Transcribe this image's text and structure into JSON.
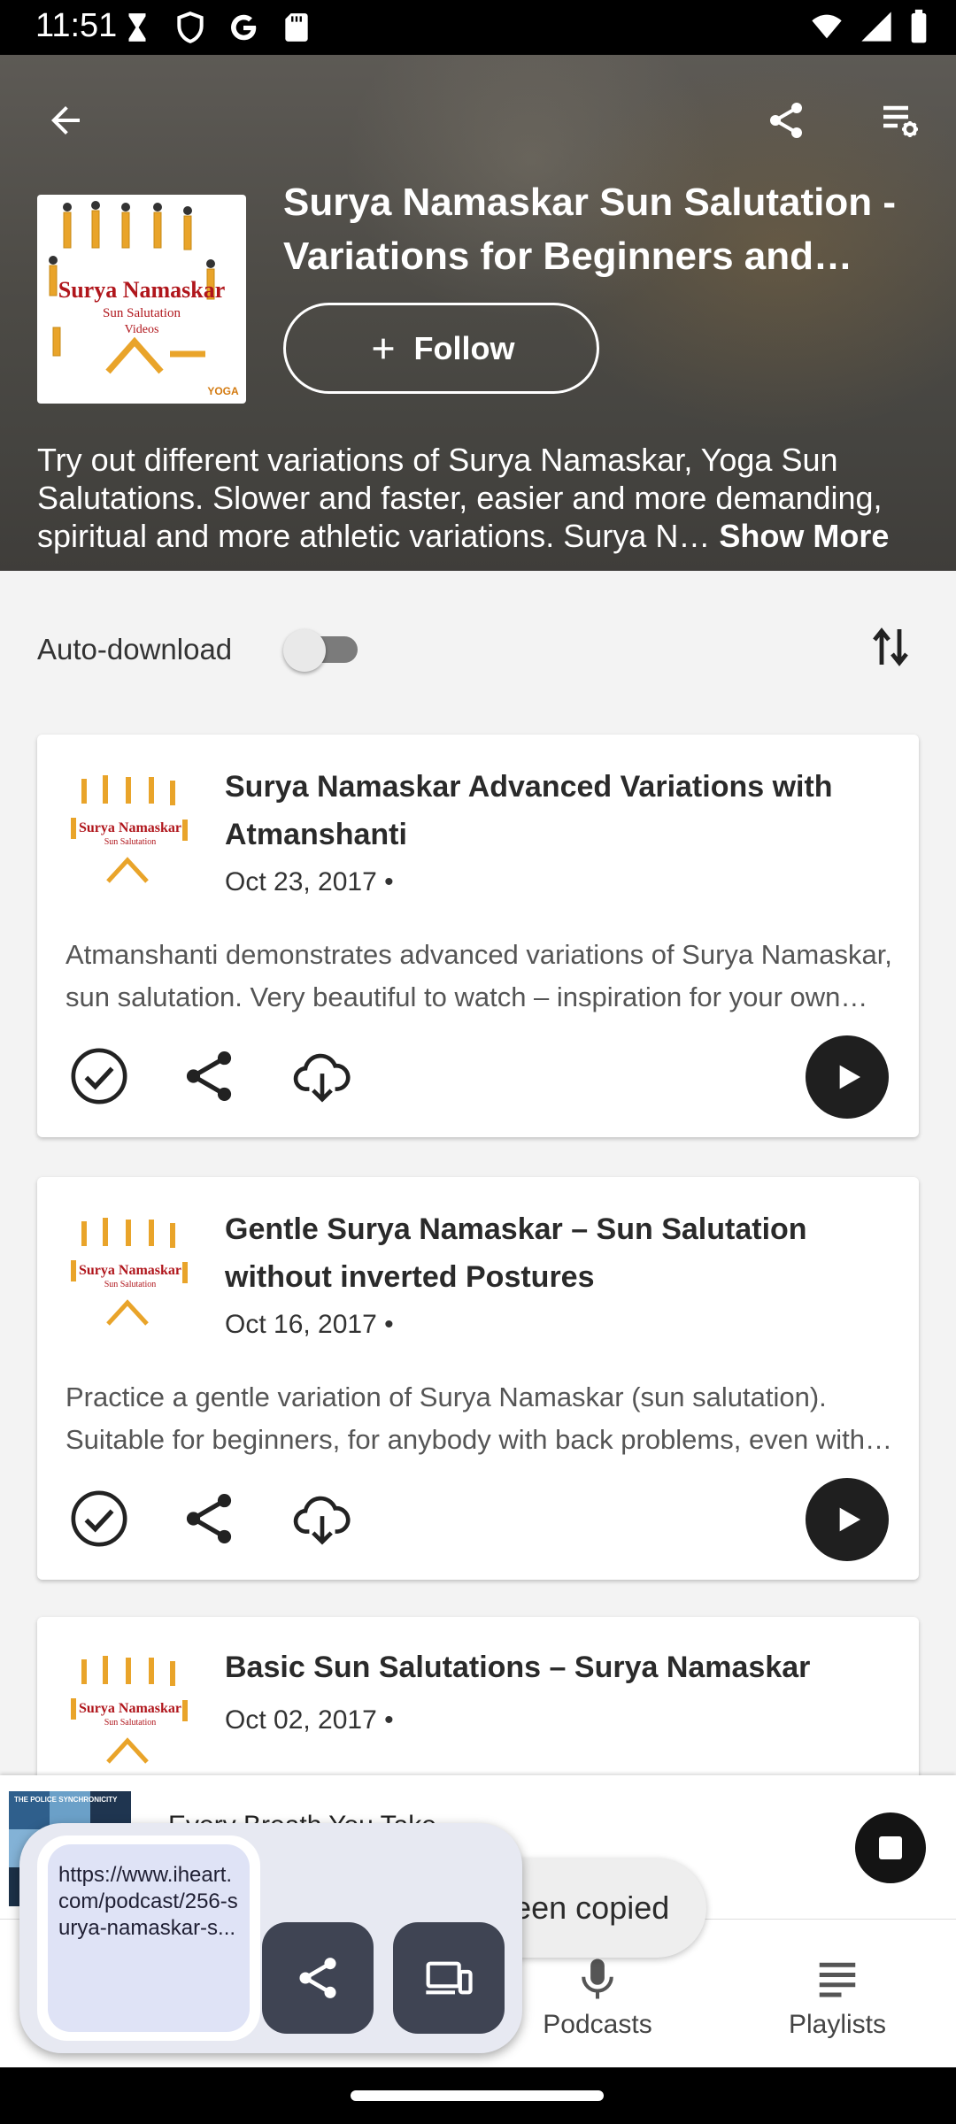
{
  "status_bar": {
    "time": "11:51",
    "icons": [
      "hourglass-icon",
      "shield-icon",
      "google-icon",
      "sd-card-icon"
    ],
    "right_icons": [
      "wifi-icon",
      "signal-icon",
      "battery-icon"
    ]
  },
  "header": {
    "title": "Surya Namaskar Sun Salutation - Variations for Beginners and Advanced",
    "follow_label": "Follow",
    "cover_text_line1": "Surya Namaskar",
    "cover_text_line2": "Sun Salutation",
    "cover_text_line3": "Videos",
    "cover_badge": "YOGA",
    "description": "Try out different variations of Surya Namaskar, Yoga Sun Salutations. Slower and faster, easier and more demanding, spiritual and more athletic variations. Surya N…",
    "show_more_label": "Show More"
  },
  "controls": {
    "auto_download_label": "Auto-download",
    "auto_download_on": false
  },
  "episodes": [
    {
      "title": "Surya Namaskar Advanced Variations with Atmanshanti",
      "date": "Oct 23, 2017 •",
      "description": "Atmanshanti demonstrates advanced variations of Surya Namaskar, sun salutation. Very beautiful to watch – inspiration for your own practice and a glimpse of what is possible."
    },
    {
      "title": "Gentle Surya Namaskar – Sun Salutation without inverted Postures",
      "date": "Oct 16, 2017 •",
      "description": "Practice a gentle variation of Surya Namaskar (sun salutation). Suitable for beginners, for anybody with back problems, even with high blood pressure."
    },
    {
      "title": "Basic Sun Salutations – Surya Namaskar",
      "date": "Oct 02, 2017 •",
      "description": ""
    }
  ],
  "mini_player": {
    "title": "Every Breath You Take",
    "subtitle": "e",
    "art_text": "THE POLICE  SYNCHRONICITY"
  },
  "toast": {
    "text": "Link has been copied"
  },
  "share_overlay": {
    "url": "https://www.iheart.com/podcast/256-surya-namaskar-s..."
  },
  "nav": {
    "items": [
      {
        "label": "Podcasts",
        "icon": "microphone-icon"
      },
      {
        "label": "Playlists",
        "icon": "playlist-icon"
      }
    ]
  },
  "colors": {
    "header_bg": "#4d4b46",
    "content_bg": "#f3f3f3",
    "play_button": "#1f1f1f",
    "overlay_button": "#3f4453",
    "iheart_red": "#c6002b"
  }
}
